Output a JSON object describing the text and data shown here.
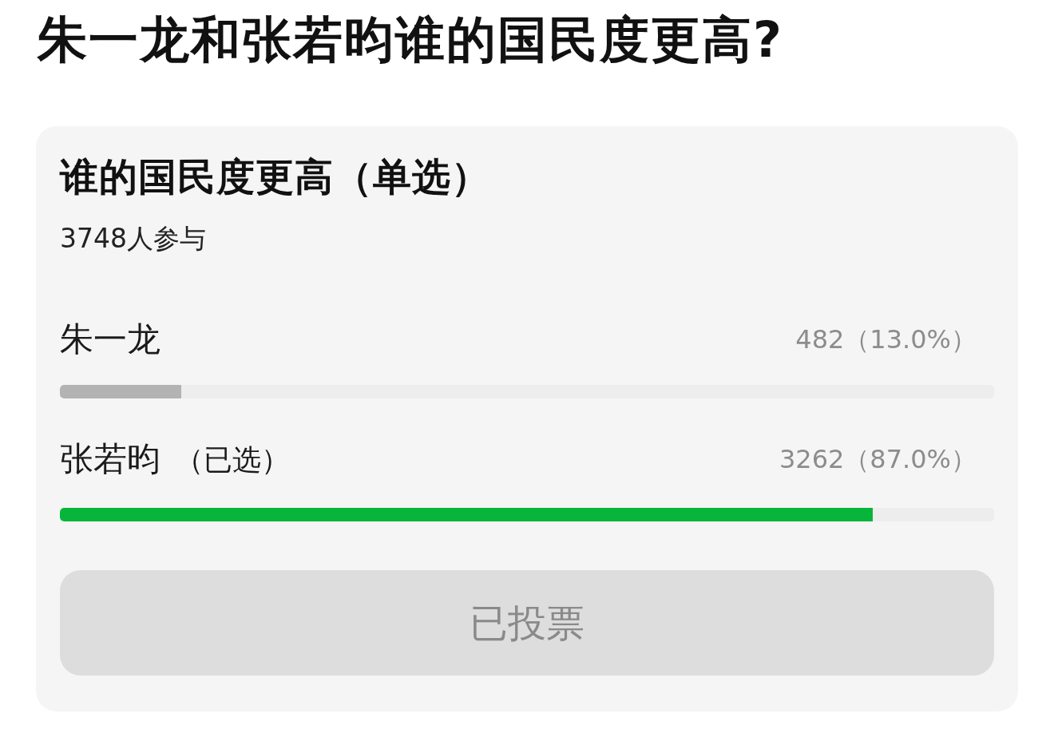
{
  "title": "朱一龙和张若昀谁的国民度更高?",
  "poll": {
    "question": "谁的国民度更高（单选）",
    "participants": "3748人参与",
    "options": [
      {
        "name": "朱一龙",
        "count": "482（13.0%）",
        "level": 0.13,
        "selected": false
      },
      {
        "name": "张若昀",
        "note": "（已选）",
        "count": "3262（87.0%）",
        "level": 0.87,
        "selected": true
      }
    ],
    "button": {
      "label": "已投票",
      "disabled": true
    }
  }
}
